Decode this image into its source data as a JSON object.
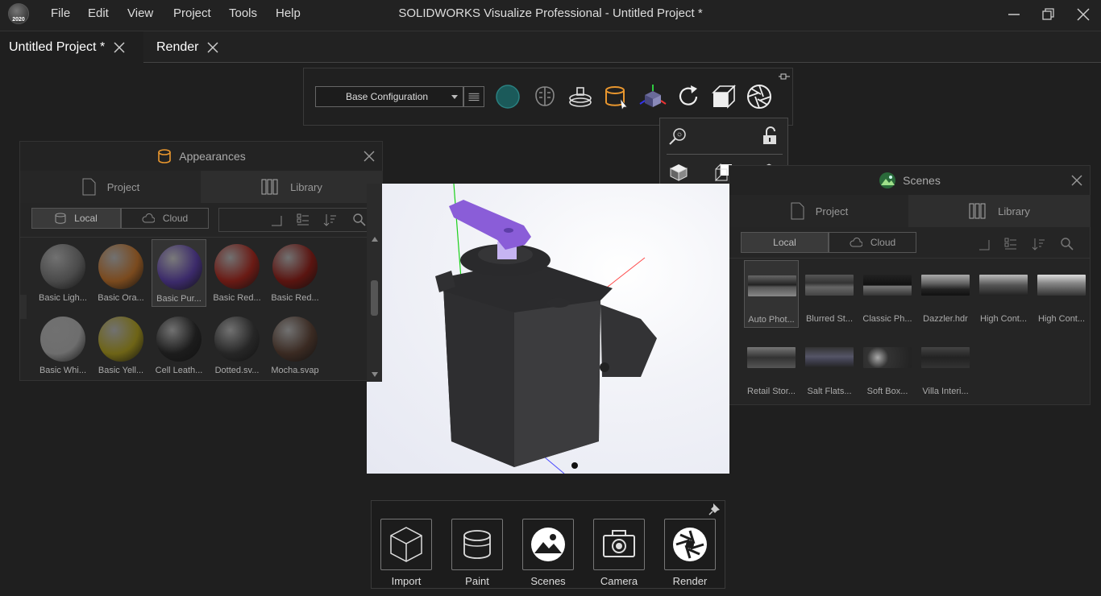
{
  "app": {
    "title": "SOLIDWORKS Visualize Professional - Untitled Project *",
    "logo_text": "2020",
    "menu": [
      "File",
      "Edit",
      "View",
      "Project",
      "Tools",
      "Help"
    ]
  },
  "tabs": [
    {
      "label": "Untitled Project *"
    },
    {
      "label": "Render"
    }
  ],
  "toolbar": {
    "configuration": "Base Configuration",
    "icons": [
      "material-ball-icon",
      "brain-icon",
      "turntable-icon",
      "paint-bucket-icon",
      "move-axes-icon",
      "refresh-icon",
      "camera-view-icon",
      "aperture-icon"
    ]
  },
  "appearances": {
    "title": "Appearances",
    "tabs": [
      "Project",
      "Library"
    ],
    "segments": [
      "Local",
      "Cloud"
    ],
    "items": [
      {
        "label": "Basic Ligh...",
        "color": "#4a4a4a"
      },
      {
        "label": "Basic Ora...",
        "color": "#7a4a1e"
      },
      {
        "label": "Basic Pur...",
        "color": "#3b2a6a"
      },
      {
        "label": "Basic Red...",
        "color": "#6a1a14"
      },
      {
        "label": "Basic Red...",
        "color": "#5a1410"
      },
      {
        "label": "Basic Whi...",
        "color": "#6e6e6e"
      },
      {
        "label": "Basic Yell...",
        "color": "#6e6416"
      },
      {
        "label": "Cell Leath...",
        "color": "#1c1c1c"
      },
      {
        "label": "Dotted.sv...",
        "color": "#262626"
      },
      {
        "label": "Mocha.svap",
        "color": "#3a2a22"
      }
    ]
  },
  "scenes": {
    "title": "Scenes",
    "tabs": [
      "Project",
      "Library"
    ],
    "segments": [
      "Local",
      "Cloud"
    ],
    "items": [
      {
        "label": "Auto Phot..."
      },
      {
        "label": "Blurred St..."
      },
      {
        "label": "Classic Ph..."
      },
      {
        "label": "Dazzler.hdr"
      },
      {
        "label": "High Cont..."
      },
      {
        "label": "High Cont..."
      },
      {
        "label": "Retail Stor..."
      },
      {
        "label": "Salt Flats..."
      },
      {
        "label": "Soft Box..."
      },
      {
        "label": "Villa Interi..."
      }
    ]
  },
  "dock": {
    "items": [
      {
        "label": "Import"
      },
      {
        "label": "Paint"
      },
      {
        "label": "Scenes"
      },
      {
        "label": "Camera"
      },
      {
        "label": "Render"
      }
    ]
  }
}
